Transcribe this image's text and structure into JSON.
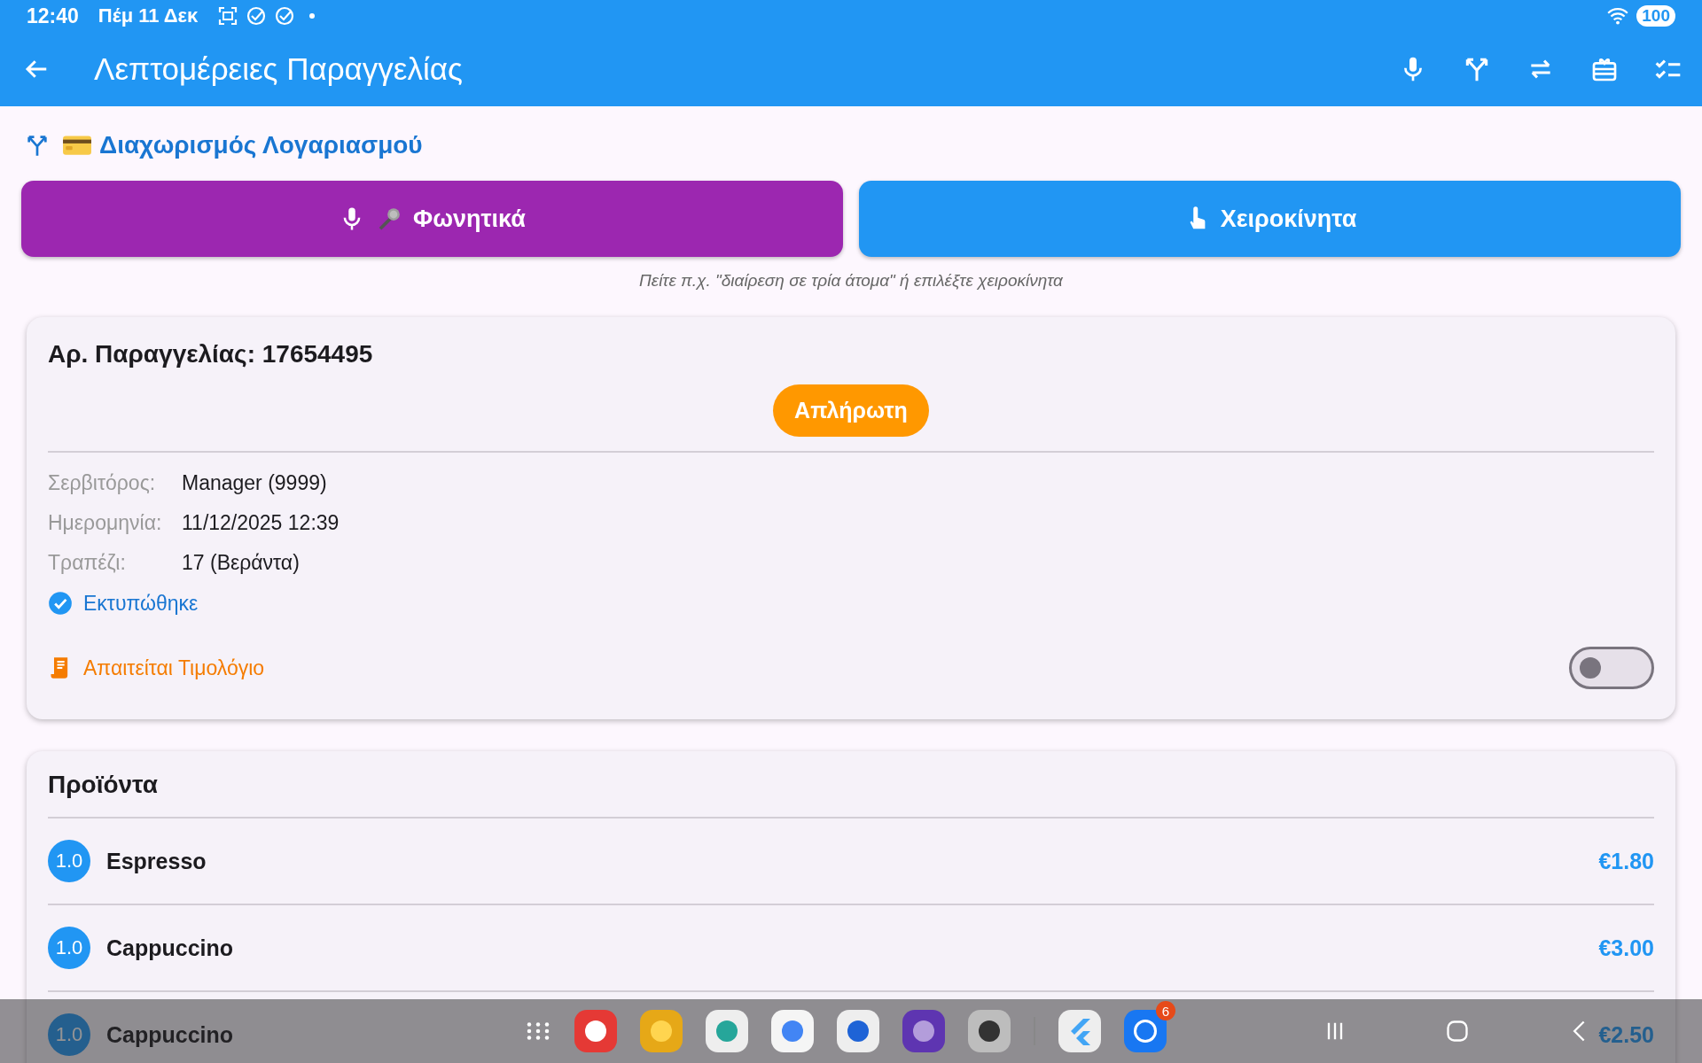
{
  "status_bar": {
    "time": "12:40",
    "date": "Πέμ 11 Δεκ",
    "battery": "100"
  },
  "app_bar": {
    "title": "Λεπτομέρειες Παραγγελίας"
  },
  "split_header": {
    "title": "Διαχωρισμός Λογαριασμού"
  },
  "modes": [
    {
      "kind": "voice",
      "label": "Φωνητικά"
    },
    {
      "kind": "manual",
      "label": "Χειροκίνητα"
    }
  ],
  "hint": "Πείτε π.χ. \"διαίρεση σε τρία άτομα\" ή επιλέξτε χειροκίνητα",
  "order": {
    "title": "Αρ. Παραγγελίας: 17654495",
    "status": "Απλήρωτη",
    "fields": [
      {
        "label": "Σερβιτόρος:",
        "value": "Manager (9999)"
      },
      {
        "label": "Ημερομηνία:",
        "value": "11/12/2025 12:39"
      },
      {
        "label": "Τραπέζι:",
        "value": "17 (Βεράντα)"
      }
    ],
    "printed": {
      "label": "Εκτυπώθηκε",
      "checked": true
    },
    "invoice": {
      "label": "Απαιτείται Τιμολόγιο",
      "on": false
    }
  },
  "products": {
    "title": "Προϊόντα",
    "items": [
      {
        "quantity": "1.0",
        "name": "Espresso",
        "price": "€1.80"
      },
      {
        "quantity": "1.0",
        "name": "Cappuccino",
        "price": "€3.00"
      },
      {
        "quantity": "1.0",
        "name": "Cappuccino",
        "price": "€2.50"
      }
    ]
  },
  "taskbar": {
    "badge": "6"
  }
}
